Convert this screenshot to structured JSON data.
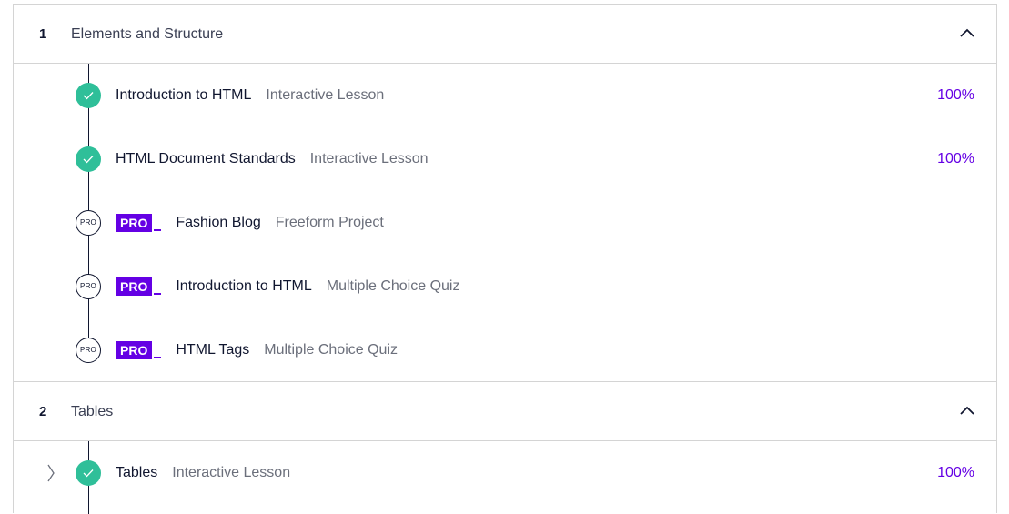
{
  "modules": [
    {
      "number": "1",
      "title": "Elements and Structure",
      "items": [
        {
          "status": "complete",
          "name": "Introduction to HTML",
          "type": "Interactive Lesson",
          "progress": "100%"
        },
        {
          "status": "complete",
          "name": "HTML Document Standards",
          "type": "Interactive Lesson",
          "progress": "100%"
        },
        {
          "status": "pro",
          "status_label": "PRO",
          "pro_tag": "PRO",
          "name": "Fashion Blog",
          "type": "Freeform Project"
        },
        {
          "status": "pro",
          "status_label": "PRO",
          "pro_tag": "PRO",
          "name": "Introduction to HTML",
          "type": "Multiple Choice Quiz"
        },
        {
          "status": "pro",
          "status_label": "PRO",
          "pro_tag": "PRO",
          "name": "HTML Tags",
          "type": "Multiple Choice Quiz"
        }
      ]
    },
    {
      "number": "2",
      "title": "Tables",
      "items": [
        {
          "status": "complete",
          "name": "Tables",
          "type": "Interactive Lesson",
          "progress": "100%"
        }
      ]
    }
  ],
  "colors": {
    "complete": "#2fbf99",
    "pro_accent": "#6400e4",
    "text_dark": "#10162f",
    "text_muted": "#6b6f7b",
    "border": "#d4d4d4"
  },
  "icons": {
    "module_toggle": "chevron-up-icon",
    "complete": "checkmark-icon",
    "row_expand": "chevron-right-icon"
  }
}
